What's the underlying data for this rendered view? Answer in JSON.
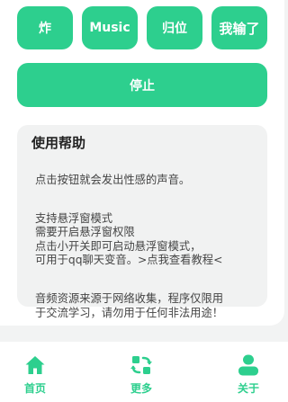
{
  "buttons": {
    "b1": "炸",
    "b2": "Music",
    "b3": "归位",
    "b4": "我输了",
    "stop": "停止"
  },
  "help": {
    "title": "使用帮助",
    "para1": "点击按钮就会发出性感的声音。",
    "para2": "支持悬浮窗模式\n需要开启悬浮窗权限\n点击小开关即可启动悬浮窗模式，\n可用于qq聊天变音。>点我查看教程<",
    "para3": "音频资源来源于网络收集，程序仅限用\n于交流学习，请勿用于任何非法用途！"
  },
  "nav": {
    "home": "首页",
    "more": "更多",
    "about": "关于"
  },
  "colors": {
    "accent": "#2dcf8e"
  },
  "icons": {
    "home": "home-icon",
    "more": "refresh-swap-icon",
    "about": "person-icon"
  }
}
